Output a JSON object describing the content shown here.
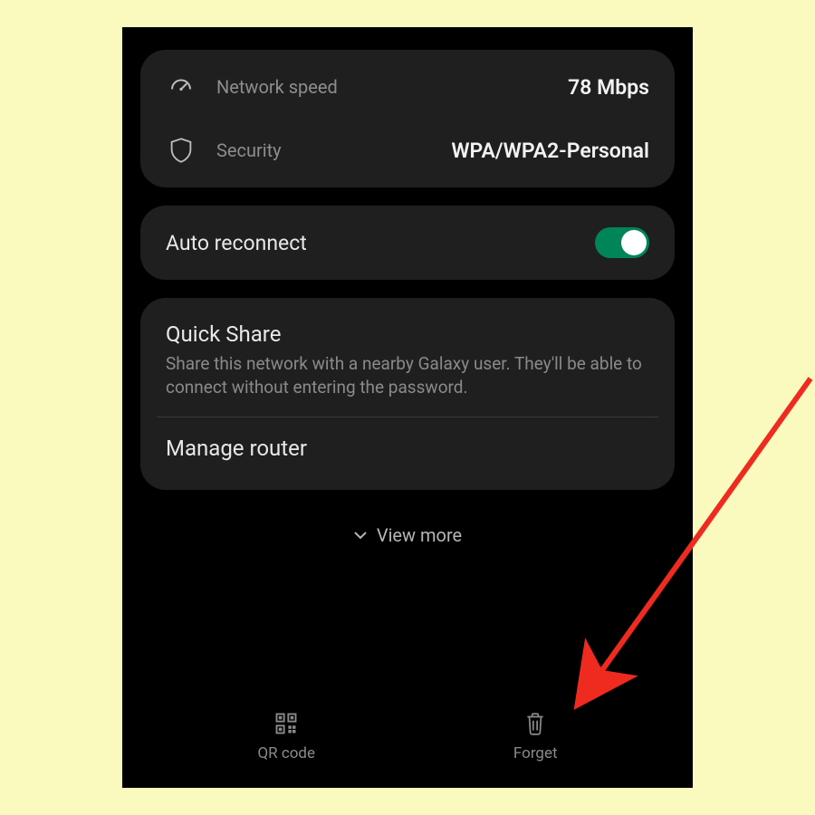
{
  "info": {
    "speed": {
      "label": "Network speed",
      "value": "78 Mbps"
    },
    "security": {
      "label": "Security",
      "value": "WPA/WPA2-Personal"
    }
  },
  "auto_reconnect": {
    "label": "Auto reconnect",
    "enabled": true
  },
  "quick_share": {
    "title": "Quick Share",
    "desc": "Share this network with a nearby Galaxy user. They'll be able to connect without entering the password."
  },
  "manage_router": {
    "label": "Manage router"
  },
  "view_more": {
    "label": "View more"
  },
  "bottom": {
    "qr": {
      "label": "QR code"
    },
    "forget": {
      "label": "Forget"
    }
  },
  "colors": {
    "accent_toggle": "#008558",
    "annotation_arrow": "#ef2a1f"
  }
}
